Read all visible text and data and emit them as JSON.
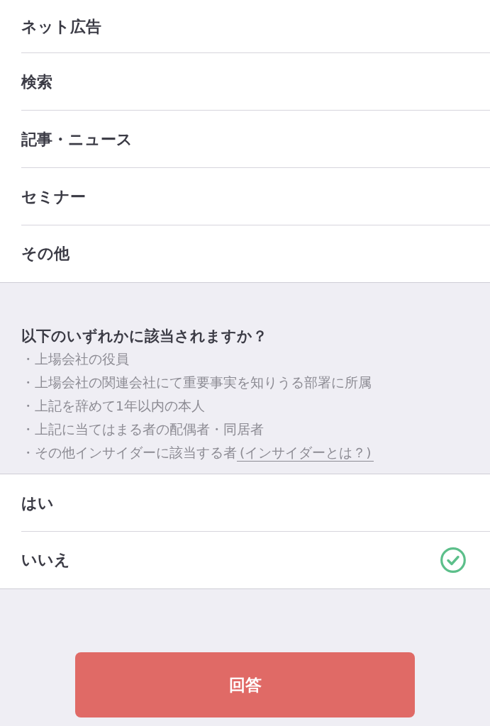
{
  "options": [
    {
      "label": "ネット広告",
      "selected": false
    },
    {
      "label": "検索",
      "selected": false
    },
    {
      "label": "記事・ニュース",
      "selected": false
    },
    {
      "label": "セミナー",
      "selected": false
    },
    {
      "label": "その他",
      "selected": false
    }
  ],
  "question": {
    "title": "以下のいずれかに該当されますか？",
    "bullets": [
      {
        "text": "・上場会社の役員"
      },
      {
        "text": "・上場会社の関連会社にて重要事実を知りうる部署に所属"
      },
      {
        "text": "・上記を辞めて1年以内の本人"
      },
      {
        "text": "・上記に当てはまる者の配偶者・同居者"
      },
      {
        "text": "・その他インサイダーに該当する者",
        "link": "(インサイダーとは？)"
      }
    ]
  },
  "answers": [
    {
      "label": "はい",
      "selected": false
    },
    {
      "label": "いいえ",
      "selected": true
    }
  ],
  "submit_button": {
    "label": "回答"
  }
}
